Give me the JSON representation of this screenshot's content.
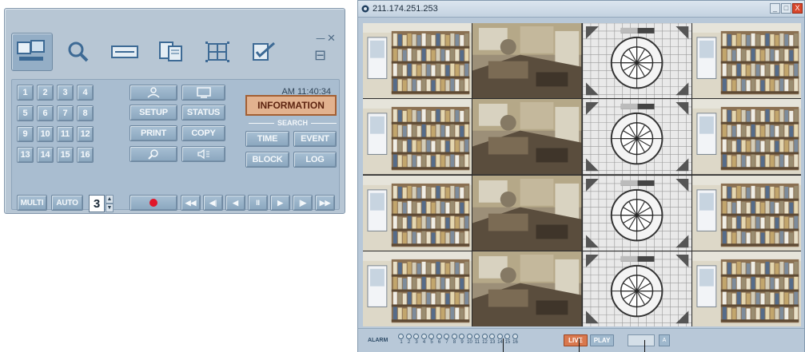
{
  "control_panel": {
    "toolbar": {
      "items": [
        {
          "name": "live-view",
          "icon": "monitor-icon",
          "active": true
        },
        {
          "name": "search",
          "icon": "magnifier-icon",
          "active": false
        },
        {
          "name": "backup",
          "icon": "recorder-icon",
          "active": false
        },
        {
          "name": "copy",
          "icon": "documents-icon",
          "active": false
        },
        {
          "name": "multi-screen",
          "icon": "quad-screen-icon",
          "active": false
        },
        {
          "name": "setup",
          "icon": "checklist-icon",
          "active": false
        }
      ]
    },
    "clock": "AM 11:40:34",
    "channels": [
      "1",
      "2",
      "3",
      "4",
      "5",
      "6",
      "7",
      "8",
      "9",
      "10",
      "11",
      "12",
      "13",
      "14",
      "15",
      "16"
    ],
    "function_buttons": {
      "row1_left": "",
      "row1_right": "",
      "setup": "SETUP",
      "status": "STATUS",
      "print": "PRINT",
      "copy": "COPY",
      "zoom": "",
      "audio": ""
    },
    "information": "INFORMATION",
    "search": {
      "label": "SEARCH",
      "time": "TIME",
      "event": "EVENT",
      "block": "BLOCK",
      "log": "LOG"
    },
    "bottom": {
      "multi": "MULTI",
      "auto": "AUTO",
      "split_value": "3",
      "spin_up": "▲",
      "spin_down": "▼"
    },
    "playback": [
      "◀◀",
      "◀|",
      "◀",
      "II",
      "▶",
      "|▶",
      "▶▶"
    ]
  },
  "viewer": {
    "title": "211.174.251.253",
    "window_buttons": [
      "_",
      "□",
      "X"
    ],
    "alarm_label": "ALARM",
    "alarm_numbers": [
      "1",
      "2",
      "3",
      "4",
      "5",
      "6",
      "7",
      "8",
      "9",
      "10",
      "11",
      "12",
      "13",
      "14",
      "15",
      "16"
    ],
    "live_label": "LIVE",
    "play_label": "PLAY",
    "status_small": "A",
    "cameras": [
      "bookshelf",
      "office",
      "test-pattern",
      "bookshelf",
      "bookshelf",
      "office",
      "test-pattern",
      "bookshelf",
      "bookshelf",
      "office",
      "test-pattern",
      "bookshelf",
      "bookshelf",
      "office",
      "test-pattern",
      "bookshelf"
    ]
  },
  "colors": {
    "panel_bg": "#b7c6d4",
    "button_face": "#9bb4c9",
    "accent_info": "#e2b28f",
    "record_red": "#e0172a",
    "live_orange": "#d9784e"
  }
}
